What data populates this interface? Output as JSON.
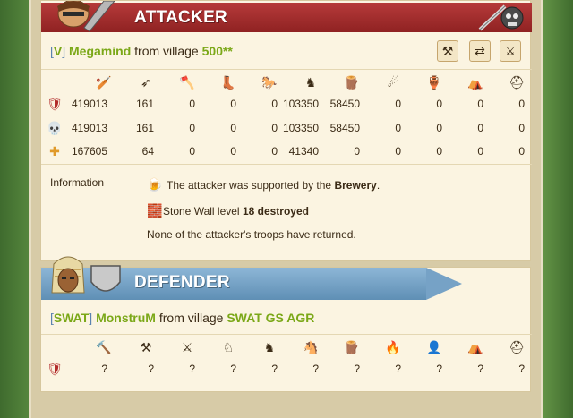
{
  "attacker": {
    "banner_title": "ATTACKER",
    "tag_open": "[",
    "tag": "V",
    "tag_close": "]",
    "player": "Megamind",
    "from_text": "from village",
    "village": "500**",
    "unit_icons": [
      "clubman-icon",
      "spearman-icon",
      "axeman-icon",
      "scout-icon",
      "paladin-icon",
      "teutonic-knight-icon",
      "ram-icon",
      "catapult-icon",
      "chief-icon",
      "settler-icon",
      "hero-icon"
    ],
    "rows": [
      {
        "icon": "troops-icon",
        "values": [
          "419013",
          "161",
          "0",
          "0",
          "0",
          "103350",
          "58450",
          "0",
          "0",
          "0",
          "0"
        ]
      },
      {
        "icon": "casualties-icon",
        "values": [
          "419013",
          "161",
          "0",
          "0",
          "0",
          "103350",
          "58450",
          "0",
          "0",
          "0",
          "0"
        ]
      },
      {
        "icon": "survivors-icon",
        "values": [
          "167605",
          "64",
          "0",
          "0",
          "0",
          "41340",
          "0",
          "0",
          "0",
          "0",
          "0"
        ]
      }
    ],
    "info_label": "Information",
    "info_supported_prefix": "The attacker was supported by the",
    "info_supported_building": "Brewery",
    "info_supported_suffix": ".",
    "info_wall_prefix": "Stone Wall level",
    "info_wall_value": "18 destroyed",
    "info_no_return": "None of the attacker's troops have returned."
  },
  "defender": {
    "banner_title": "DEFENDER",
    "tag_open": "[",
    "tag": "SWAT",
    "tag_close": "]",
    "player": "MonstruM",
    "from_text": "from village",
    "village": "SWAT GS AGR",
    "unit_icons": [
      "legionnaire-icon",
      "praetorian-icon",
      "imperian-icon",
      "equites-legati-icon",
      "equites-imperatoris-icon",
      "equites-caesaris-icon",
      "battering-ram-icon",
      "fire-catapult-icon",
      "senator-icon",
      "settler-icon",
      "hero-icon"
    ],
    "row_values": [
      "?",
      "?",
      "?",
      "?",
      "?",
      "?",
      "?",
      "?",
      "?",
      "?",
      "?"
    ]
  },
  "colors": {
    "attacker_banner": "#a92f2f",
    "defender_banner": "#76a2c6",
    "player_green": "#7ba818",
    "tag_blue": "#5b83b0"
  }
}
